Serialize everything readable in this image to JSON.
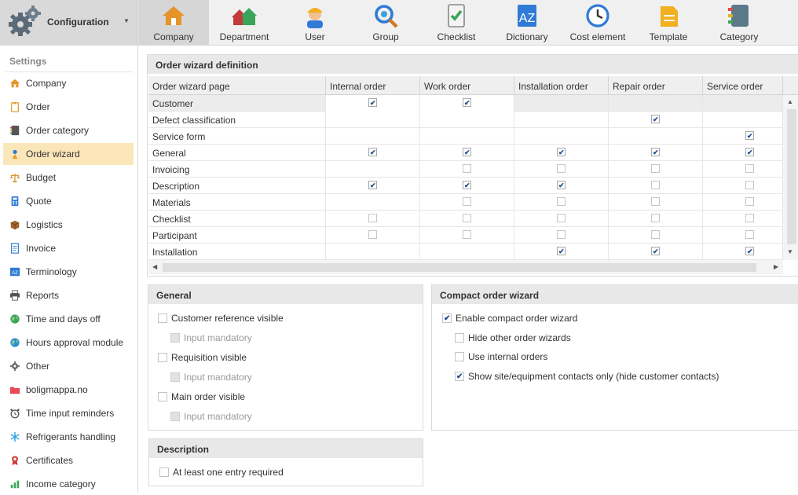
{
  "topbar": {
    "config_label": "Configuration",
    "nav": [
      {
        "label": "Company",
        "icon": "house-icon",
        "active": true
      },
      {
        "label": "Department",
        "icon": "houses-icon",
        "active": false
      },
      {
        "label": "User",
        "icon": "worker-icon",
        "active": false
      },
      {
        "label": "Group",
        "icon": "group-search-icon",
        "active": false
      },
      {
        "label": "Checklist",
        "icon": "checklist-icon",
        "active": false
      },
      {
        "label": "Dictionary",
        "icon": "dictionary-icon",
        "active": false
      },
      {
        "label": "Cost element",
        "icon": "clock-icon",
        "active": false
      },
      {
        "label": "Template",
        "icon": "template-icon",
        "active": false
      },
      {
        "label": "Category",
        "icon": "category-icon",
        "active": false
      }
    ]
  },
  "sidebar": {
    "title": "Settings",
    "items": [
      {
        "label": "Company",
        "icon": "house-icon",
        "color": "#e6942a"
      },
      {
        "label": "Order",
        "icon": "clipboard-icon",
        "color": "#e0a030"
      },
      {
        "label": "Order category",
        "icon": "category-icon",
        "color": "#555555"
      },
      {
        "label": "Order wizard",
        "icon": "wizard-icon",
        "color": "#2f7bd6",
        "active": true
      },
      {
        "label": "Budget",
        "icon": "scale-icon",
        "color": "#d49a2a"
      },
      {
        "label": "Quote",
        "icon": "calculator-icon",
        "color": "#2f7bd6"
      },
      {
        "label": "Logistics",
        "icon": "box-icon",
        "color": "#a0652a"
      },
      {
        "label": "Invoice",
        "icon": "invoice-icon",
        "color": "#2f7bd6"
      },
      {
        "label": "Terminology",
        "icon": "terminology-icon",
        "color": "#2f7bd6"
      },
      {
        "label": "Reports",
        "icon": "printer-icon",
        "color": "#555555"
      },
      {
        "label": "Time and days off",
        "icon": "globe-icon",
        "color": "#3aa55a"
      },
      {
        "label": "Hours approval module",
        "icon": "globe-icon",
        "color": "#2f8fd6"
      },
      {
        "label": "Other",
        "icon": "gear-icon",
        "color": "#666666"
      },
      {
        "label": "boligmappa.no",
        "icon": "folder-icon",
        "color": "#e84a5a"
      },
      {
        "label": "Time input reminders",
        "icon": "alarm-icon",
        "color": "#555555"
      },
      {
        "label": "Refrigerants handling",
        "icon": "snowflake-icon",
        "color": "#2fa0e0"
      },
      {
        "label": "Certificates",
        "icon": "certificate-icon",
        "color": "#d43a3a"
      },
      {
        "label": "Income category",
        "icon": "income-icon",
        "color": "#3aa55a"
      }
    ]
  },
  "wizard": {
    "title": "Order wizard definition",
    "columns": [
      "Order wizard page",
      "Internal order",
      "Work order",
      "Installation order",
      "Repair order",
      "Service order"
    ],
    "rows": [
      {
        "name": "Customer",
        "cells": [
          "on",
          "on",
          "none",
          "none",
          "none"
        ]
      },
      {
        "name": "Defect classification",
        "cells": [
          "none",
          "none",
          "none",
          "on",
          "none"
        ]
      },
      {
        "name": "Service form",
        "cells": [
          "none",
          "none",
          "none",
          "none",
          "on"
        ]
      },
      {
        "name": "General",
        "cells": [
          "on",
          "on",
          "on",
          "on",
          "on"
        ]
      },
      {
        "name": "Invoicing",
        "cells": [
          "none",
          "off",
          "off",
          "off",
          "off"
        ]
      },
      {
        "name": "Description",
        "cells": [
          "on",
          "on",
          "on",
          "off",
          "off"
        ]
      },
      {
        "name": "Materials",
        "cells": [
          "none",
          "off",
          "off",
          "off",
          "off"
        ]
      },
      {
        "name": "Checklist",
        "cells": [
          "off",
          "off",
          "off",
          "off",
          "off"
        ]
      },
      {
        "name": "Participant",
        "cells": [
          "off",
          "off",
          "off",
          "off",
          "off"
        ]
      },
      {
        "name": "Installation",
        "cells": [
          "none",
          "none",
          "on",
          "on",
          "on"
        ]
      }
    ]
  },
  "general": {
    "title": "General",
    "options": [
      {
        "label": "Customer reference visible",
        "checked": false,
        "disabled": false,
        "indent": false
      },
      {
        "label": "Input mandatory",
        "checked": false,
        "disabled": true,
        "indent": true
      },
      {
        "label": "Requisition visible",
        "checked": false,
        "disabled": false,
        "indent": false
      },
      {
        "label": "Input mandatory",
        "checked": false,
        "disabled": true,
        "indent": true
      },
      {
        "label": "Main order visible",
        "checked": false,
        "disabled": false,
        "indent": false
      },
      {
        "label": "Input mandatory",
        "checked": false,
        "disabled": true,
        "indent": true
      }
    ]
  },
  "compact": {
    "title": "Compact order wizard",
    "options": [
      {
        "label": "Enable compact order wizard",
        "checked": true,
        "disabled": false,
        "indent": false
      },
      {
        "label": "Hide other order wizards",
        "checked": false,
        "disabled": false,
        "indent": true
      },
      {
        "label": "Use internal orders",
        "checked": false,
        "disabled": false,
        "indent": true
      },
      {
        "label": "Show site/equipment contacts only (hide customer contacts)",
        "checked": true,
        "disabled": false,
        "indent": true
      }
    ]
  },
  "description": {
    "title": "Description",
    "options": [
      {
        "label": "At least one entry required",
        "checked": false,
        "disabled": false,
        "indent": false
      }
    ]
  }
}
